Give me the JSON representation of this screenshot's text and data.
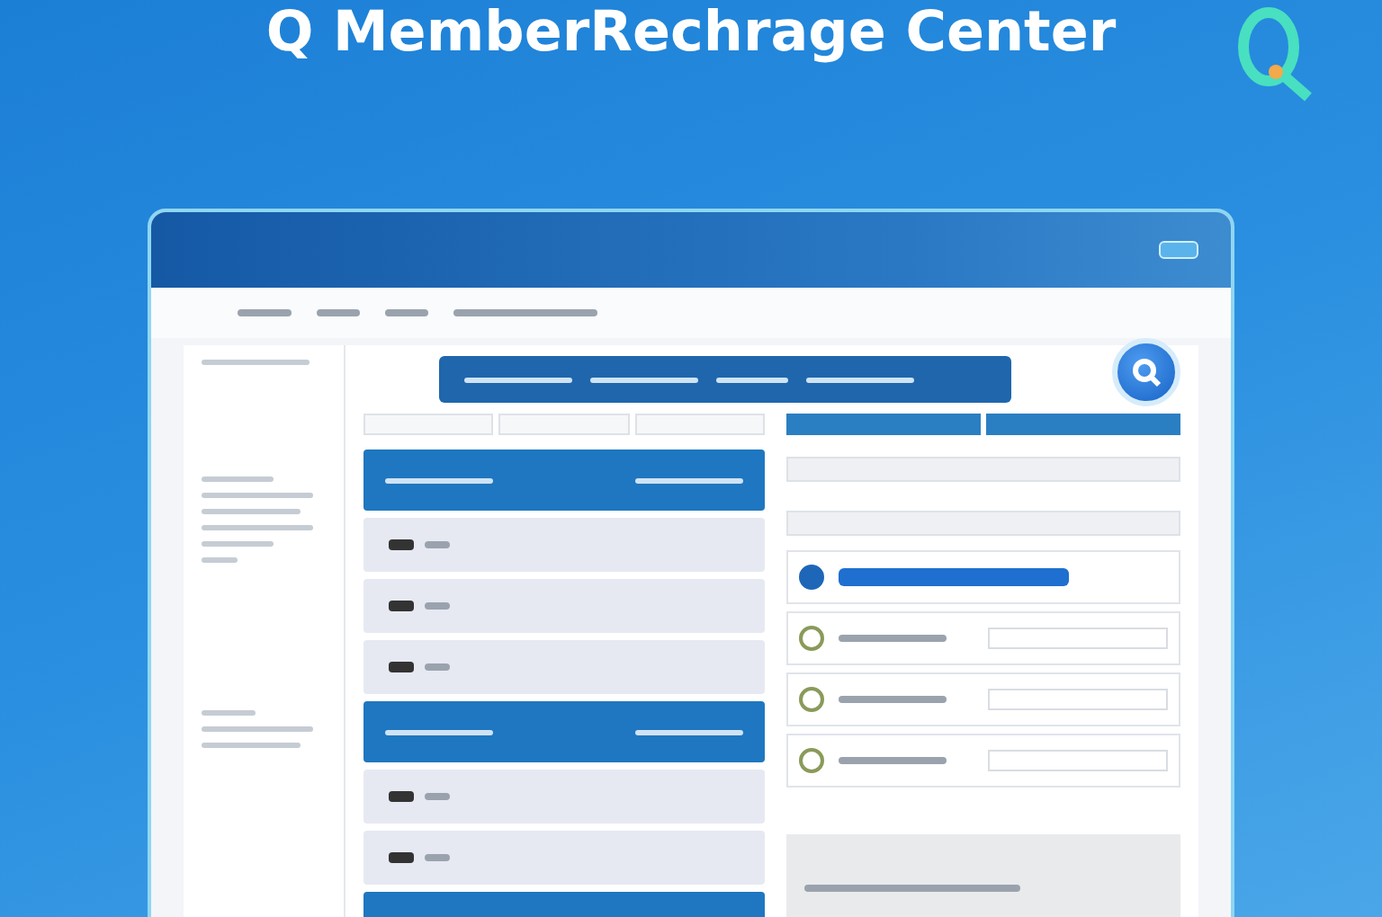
{
  "title": "Q MemberRechrage Center",
  "tabs": [
    {
      "selected": false
    },
    {
      "selected": false
    },
    {
      "selected": false
    },
    {
      "selected": true
    },
    {
      "selected": true
    }
  ],
  "plans": [
    {
      "kind": "header"
    },
    {
      "kind": "item"
    },
    {
      "kind": "item"
    },
    {
      "kind": "item"
    },
    {
      "kind": "header"
    },
    {
      "kind": "item"
    },
    {
      "kind": "item"
    },
    {
      "kind": "header"
    }
  ],
  "options": [
    {
      "selected": true
    },
    {
      "selected": false
    },
    {
      "selected": false
    },
    {
      "selected": false
    }
  ]
}
